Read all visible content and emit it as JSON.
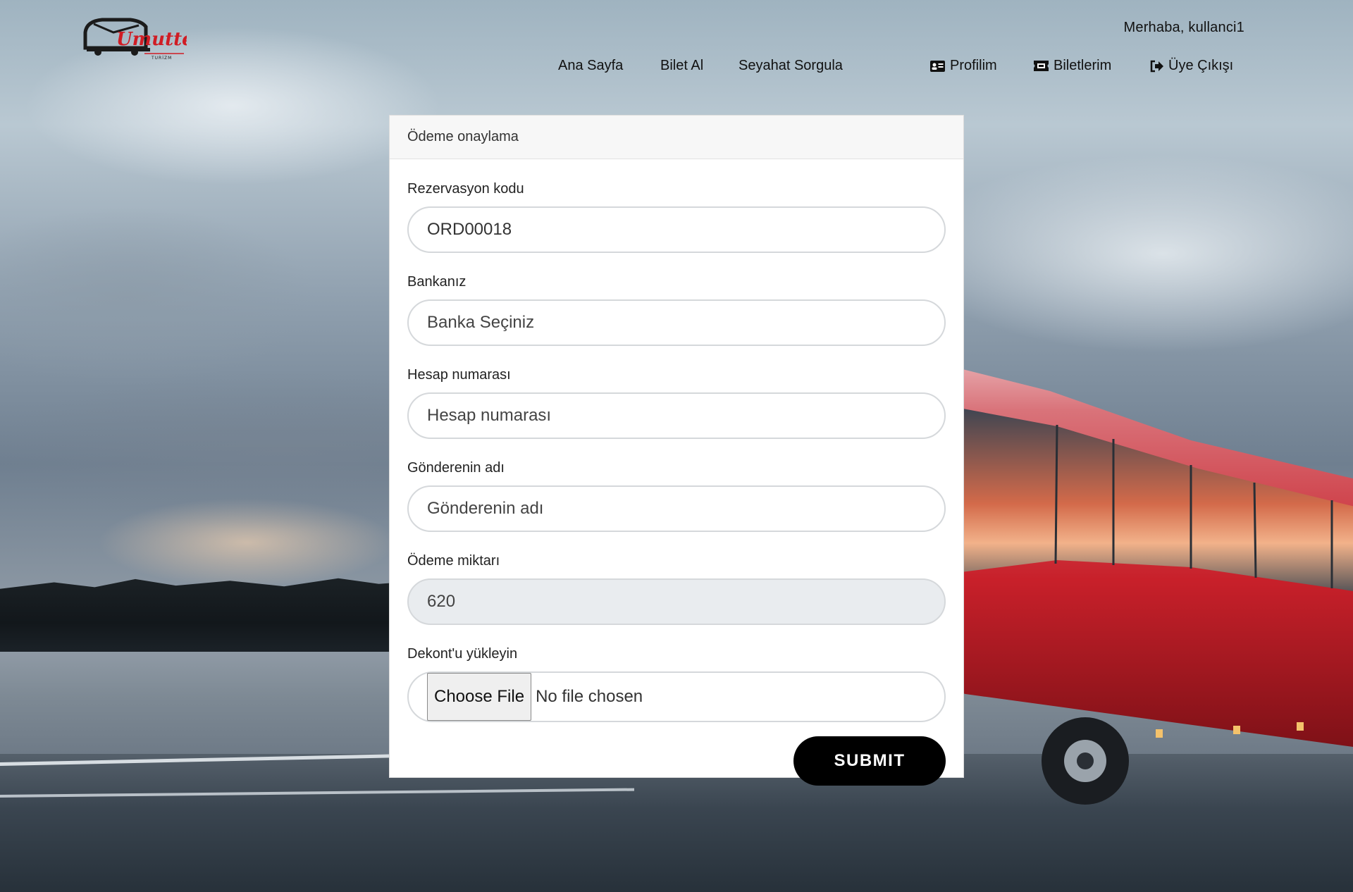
{
  "header": {
    "greeting": "Merhaba, kullanci1",
    "logo_text": "Umuttepe",
    "logo_subtext": "TURİZM"
  },
  "nav": {
    "home": "Ana Sayfa",
    "buy_ticket": "Bilet Al",
    "trip_query": "Seyahat Sorgula",
    "profile": "Profilim",
    "tickets": "Biletlerim",
    "logout": "Üye Çıkışı"
  },
  "form": {
    "title": "Ödeme onaylama",
    "reservation_label": "Rezervasyon kodu",
    "reservation_value": "ORD00018",
    "bank_label": "Bankanız",
    "bank_value": "Banka Seçiniz",
    "account_label": "Hesap numarası",
    "account_placeholder": "Hesap numarası",
    "sender_label": "Gönderenin adı",
    "sender_placeholder": "Gönderenin adı",
    "amount_label": "Ödeme miktarı",
    "amount_value": "620",
    "receipt_label": "Dekont'u yükleyin",
    "file_button": "Choose File",
    "file_status": "No file chosen",
    "submit_label": "SUBMIT"
  },
  "colors": {
    "logo_red": "#d01c24",
    "submit_bg": "#000000",
    "bus_red": "#c8202a"
  }
}
